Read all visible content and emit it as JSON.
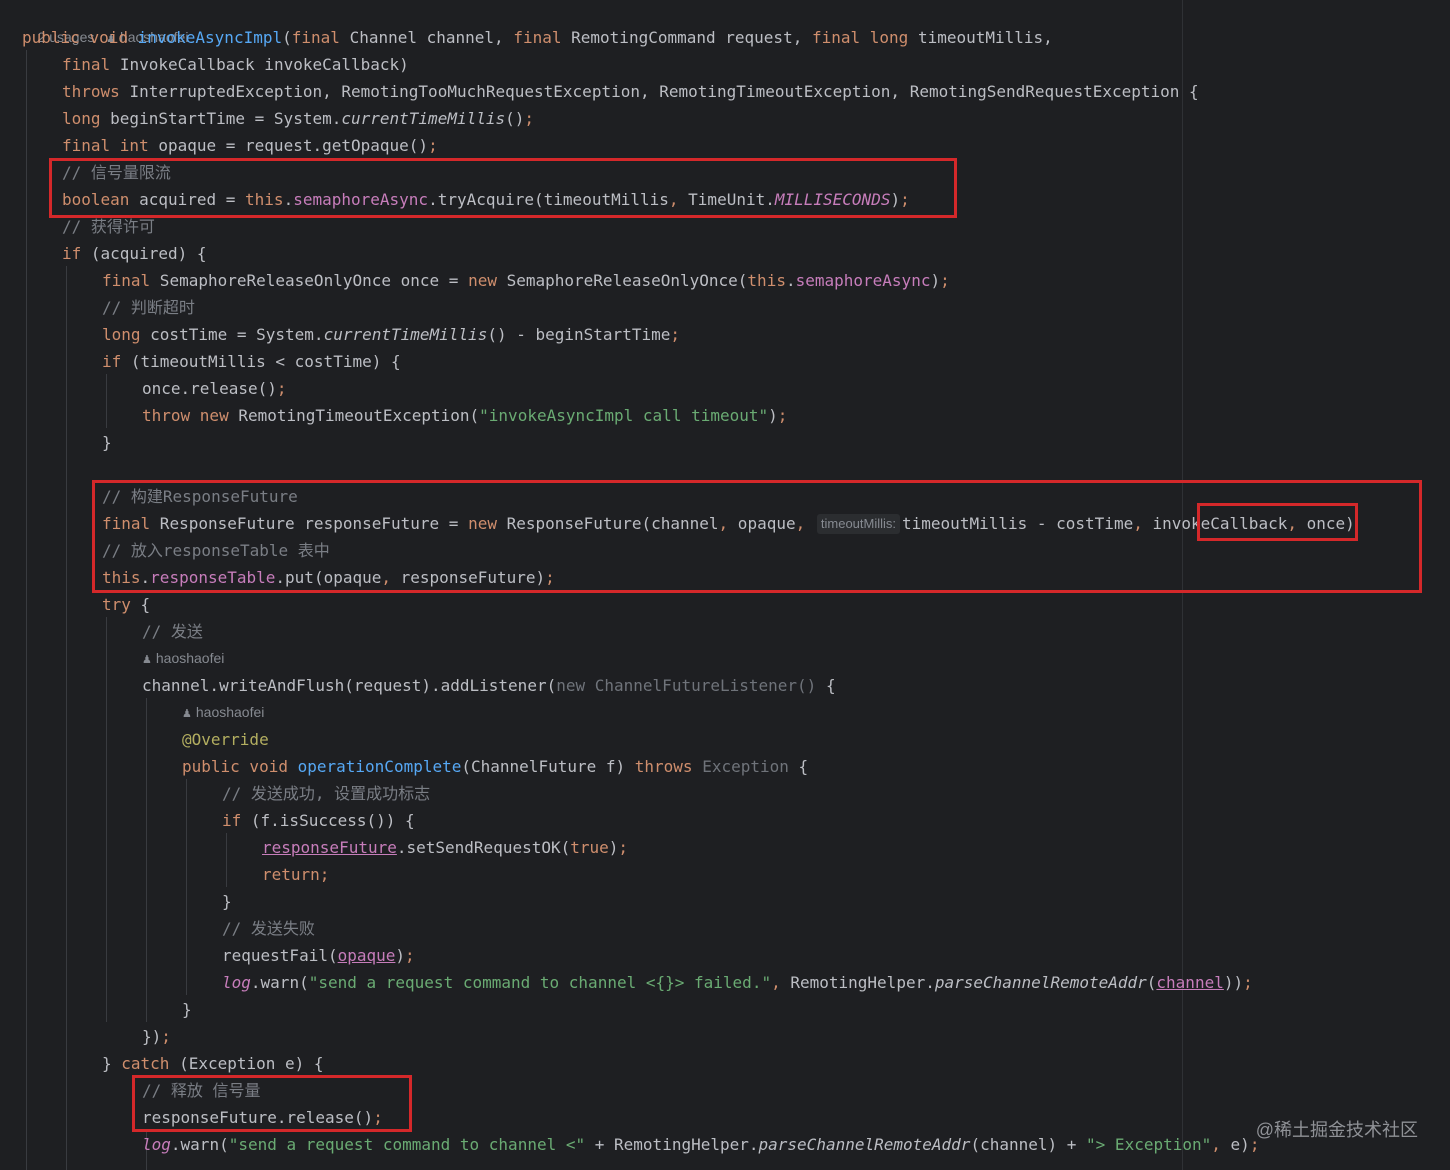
{
  "header": {
    "usages": "2 usages",
    "author": "haoshaofei"
  },
  "code": {
    "l1": "invokeAsyncImpl",
    "l1_params": "Channel channel, ",
    "l1_p2": "RemotingCommand request, ",
    "l1_p3": "timeoutMillis,",
    "l2": "InvokeCallback invokeCallback)",
    "l3_exc": "InterruptedException, RemotingTooMuchRequestException, RemotingTimeoutException, RemotingSendRequestException {",
    "c_semaphore": "// 信号量限流",
    "c_acquire": "// 获得许可",
    "c_timeout": "// 判断超时",
    "timeout_msg": "\"invokeAsyncImpl call timeout\"",
    "c_build": "// 构建ResponseFuture",
    "hint_timeout": "timeoutMillis:",
    "c_table": "// 放入responseTable 表中",
    "c_send": "// 发送",
    "author2": "haoshaofei",
    "author3": "haoshaofei",
    "annotation": "@Override",
    "c_success": "// 发送成功, 设置成功标志",
    "c_fail": "// 发送失败",
    "warn_msg": "\"send a request command to channel <{}> failed.\"",
    "c_release": "// 释放 信号量",
    "warn2_a": "\"send a request command to channel <\"",
    "warn2_b": "\"> Exception\""
  },
  "watermark": "@稀土掘金技术社区"
}
